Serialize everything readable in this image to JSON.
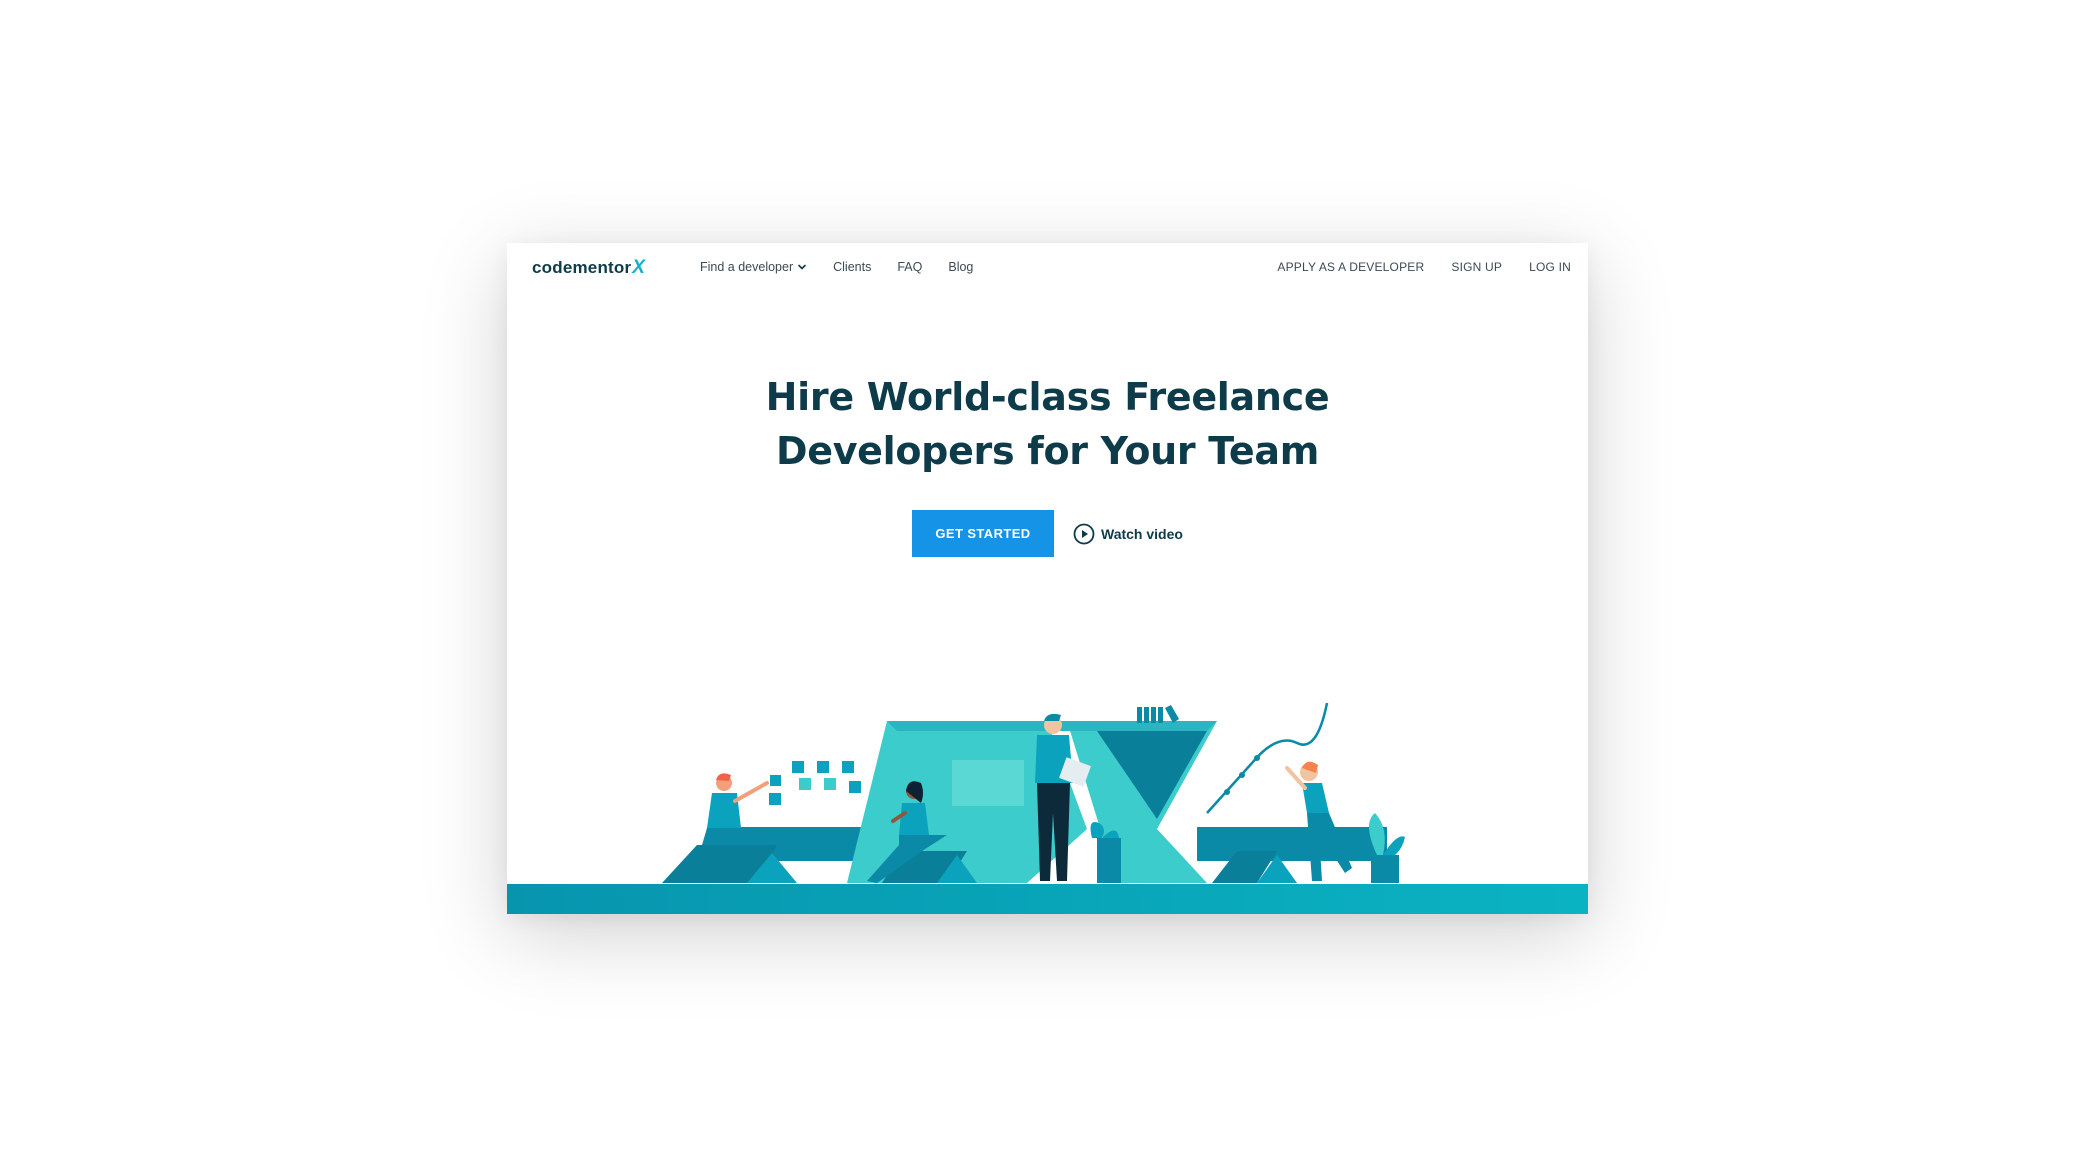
{
  "nav": {
    "logo_text": "codementor",
    "logo_accent": "X",
    "left_items": [
      {
        "label": "Find a developer",
        "has_dropdown": true
      },
      {
        "label": "Clients"
      },
      {
        "label": "FAQ"
      },
      {
        "label": "Blog"
      }
    ],
    "right_items": [
      {
        "label": "APPLY AS A DEVELOPER"
      },
      {
        "label": "SIGN UP"
      },
      {
        "label": "LOG IN"
      }
    ]
  },
  "hero": {
    "title_line1": "Hire World-class Freelance",
    "title_line2": "Developers for Your Team",
    "primary_cta": "GET STARTED",
    "secondary_cta": "Watch video"
  },
  "colors": {
    "brand_dark": "#0d3b4a",
    "brand_accent": "#10b3c6",
    "primary_button": "#1593e6",
    "teal_ground": "#0aa3b8"
  },
  "icons": {
    "dropdown": "chevron-down-icon",
    "play": "play-circle-icon"
  }
}
